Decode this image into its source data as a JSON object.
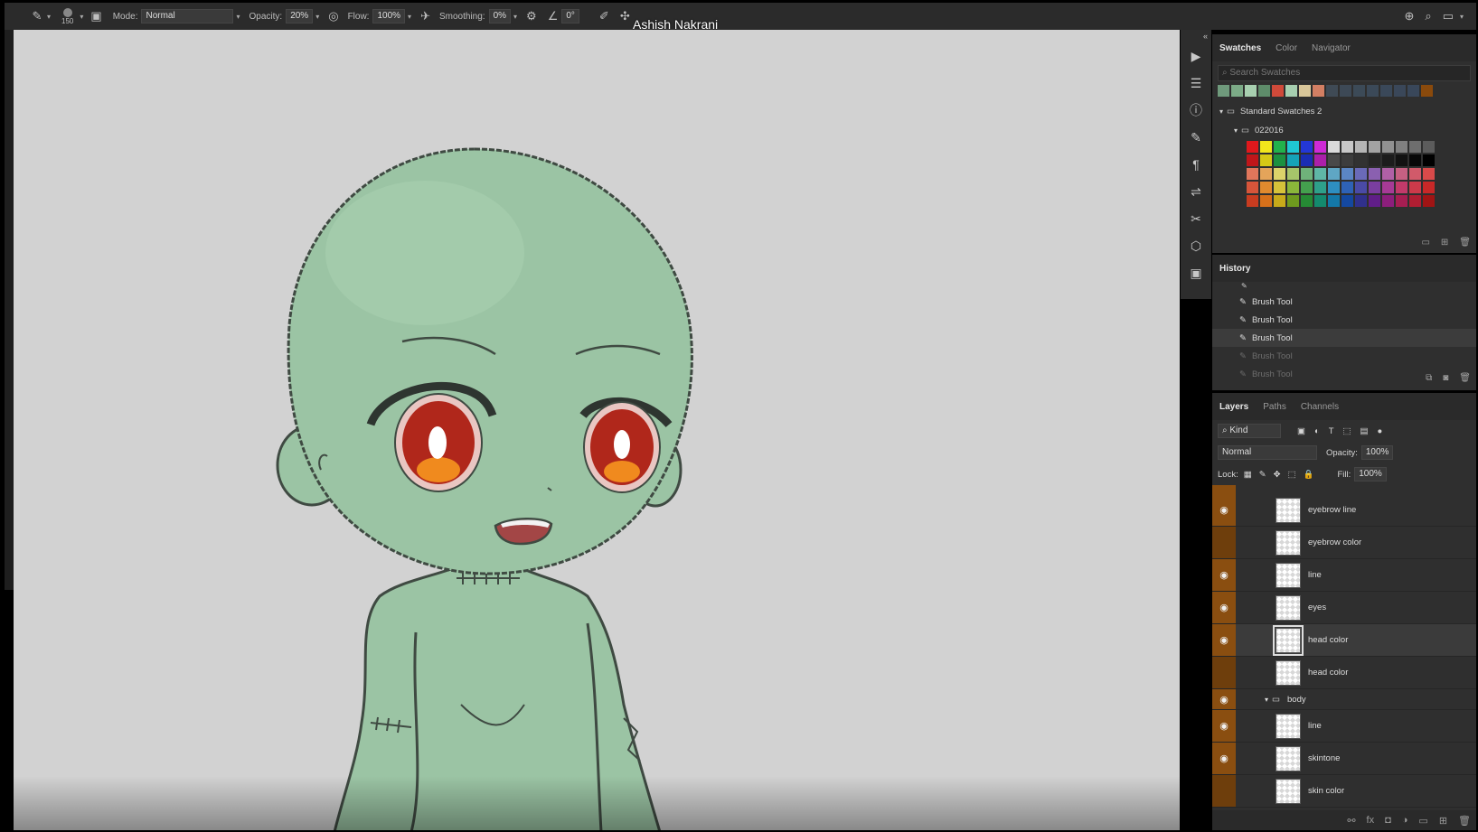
{
  "watermark": "Ashish Nakrani",
  "options": {
    "brush_size": "150",
    "mode_label": "Mode:",
    "mode_value": "Normal",
    "opacity_label": "Opacity:",
    "opacity_value": "20%",
    "flow_label": "Flow:",
    "flow_value": "100%",
    "smoothing_label": "Smoothing:",
    "smoothing_value": "0%",
    "angle_value": "0°"
  },
  "colors": {
    "skin": "#9bc4a4",
    "line": "#3f4a42",
    "canvas_bg": "#d2d2d2",
    "eye_iris": "#b0271b",
    "eye_glow": "#f08a1e",
    "layer_eye_strip": "#8a4e10"
  },
  "swatches_panel": {
    "tabs": [
      "Swatches",
      "Color",
      "Navigator"
    ],
    "search_placeholder": "Search Swatches",
    "recent": [
      "#6f9a7c",
      "#7cab87",
      "#a8d0b0",
      "#5e8c6a",
      "#d04a3a",
      "#a7cfb0",
      "#d9c79a",
      "#d37f63",
      "#3f4a55",
      "#3d4956",
      "#3c4a57",
      "#3b4958",
      "#3a4859",
      "#3a4759",
      "#39475a",
      "#8a4a0c"
    ],
    "group_title": "Standard Swatches 2",
    "subgroup_title": "022016",
    "grid": [
      [
        "#e0181c",
        "#f1e61c",
        "#22b14c",
        "#1fc7d4",
        "#2337d6",
        "#cf2ad6",
        "#dadada",
        "#c8c8c8",
        "#b5b5b5",
        "#a3a3a3",
        "#919191",
        "#808080",
        "#6e6e6e",
        "#5c5c5c"
      ],
      [
        "#c0161a",
        "#d6c916",
        "#1c9140",
        "#15a3b8",
        "#1a2db3",
        "#ab1fa9",
        "#494949",
        "#3d3d3d",
        "#323232",
        "#262626",
        "#1c1c1c",
        "#121212",
        "#080808",
        "#000000"
      ],
      [
        "#e0765b",
        "#e4a45a",
        "#dcd36a",
        "#a6c46a",
        "#6fb27a",
        "#5fb6a6",
        "#5fa6c4",
        "#5b86c4",
        "#6a6ab8",
        "#8a60b0",
        "#b060a6",
        "#c66082",
        "#d15a6a",
        "#d84a4a"
      ],
      [
        "#d6553a",
        "#e08a2e",
        "#d6c23a",
        "#8ab63a",
        "#44a04e",
        "#2ea08a",
        "#2e8ec0",
        "#2e62b6",
        "#4a4aa6",
        "#7a3ea0",
        "#a63a96",
        "#c23a6a",
        "#cc3a4a",
        "#c82828"
      ],
      [
        "#c83c20",
        "#d6701a",
        "#c8aa1a",
        "#6e9a1e",
        "#268a34",
        "#148a6e",
        "#1478a8",
        "#1448a0",
        "#30308c",
        "#601e88",
        "#8c1e7c",
        "#a61e52",
        "#b01e32",
        "#a01414"
      ]
    ]
  },
  "history_panel": {
    "title": "History",
    "items": [
      {
        "label": "Brush Tool",
        "state": "normal"
      },
      {
        "label": "Brush Tool",
        "state": "normal"
      },
      {
        "label": "Brush Tool",
        "state": "selected"
      },
      {
        "label": "Brush Tool",
        "state": "dim"
      },
      {
        "label": "Brush Tool",
        "state": "dim"
      }
    ]
  },
  "layers_panel": {
    "tabs": [
      "Layers",
      "Paths",
      "Channels"
    ],
    "filter_label": "Kind",
    "blend_mode": "Normal",
    "opacity_label": "Opacity:",
    "opacity_value": "100%",
    "lock_label": "Lock:",
    "fill_label": "Fill:",
    "fill_value": "100%",
    "layers": [
      {
        "name": "eyebrow line",
        "visible": true
      },
      {
        "name": "eyebrow color",
        "visible": false
      },
      {
        "name": "line",
        "visible": true
      },
      {
        "name": "eyes",
        "visible": true
      },
      {
        "name": "head color",
        "visible": true,
        "selected": true
      },
      {
        "name": "head color",
        "visible": false
      },
      {
        "name": "body",
        "visible": true,
        "group": true
      },
      {
        "name": "line",
        "visible": true
      },
      {
        "name": "skintone",
        "visible": true
      },
      {
        "name": "skin color",
        "visible": false
      }
    ]
  }
}
